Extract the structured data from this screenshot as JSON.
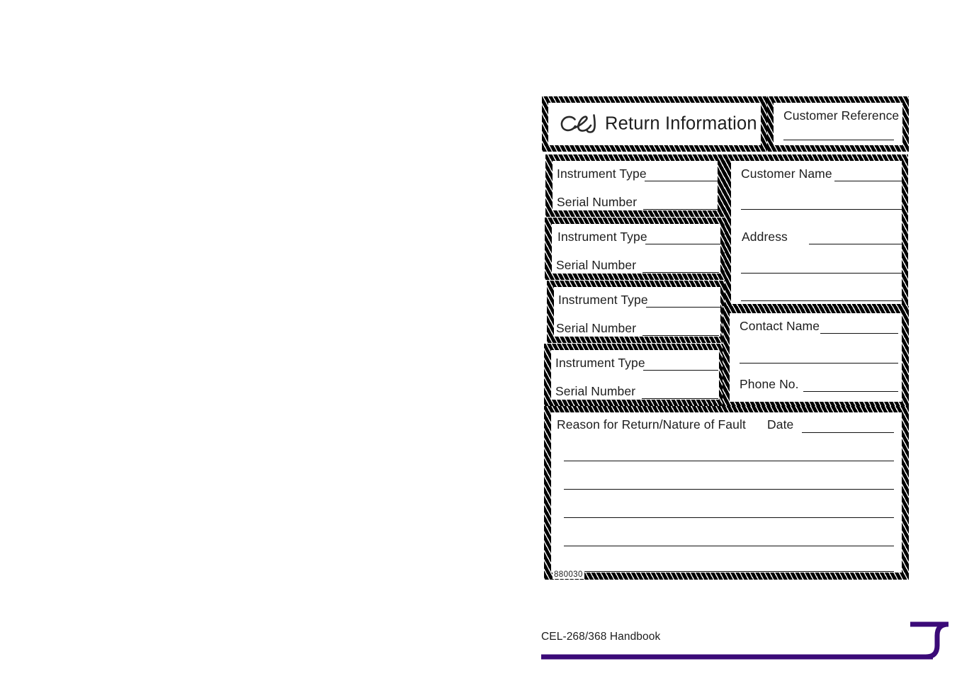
{
  "page": {
    "background_color": "#ffffff",
    "accent_color": "#3b0a78"
  },
  "form": {
    "header": {
      "logo_name": "cel-logo",
      "title": "Return Information",
      "customer_reference_label": "Customer Reference"
    },
    "instrument_blocks": [
      {
        "instrument_type_label": "Instrument Type",
        "serial_number_label": "Serial Number"
      },
      {
        "instrument_type_label": "Instrument Type",
        "serial_number_label": "Serial Number"
      },
      {
        "instrument_type_label": "Instrument Type",
        "serial_number_label": "Serial Number"
      },
      {
        "instrument_type_label": "Instrument Type",
        "serial_number_label": "Serial Number"
      }
    ],
    "customer": {
      "customer_name_label": "Customer Name",
      "address_label": "Address"
    },
    "contact": {
      "contact_name_label": "Contact Name",
      "phone_label": "Phone No."
    },
    "reason": {
      "reason_label": "Reason for Return/Nature of Fault",
      "date_label": "Date"
    },
    "form_code": "880030"
  },
  "footer": {
    "text": "CEL-268/368 Handbook"
  }
}
